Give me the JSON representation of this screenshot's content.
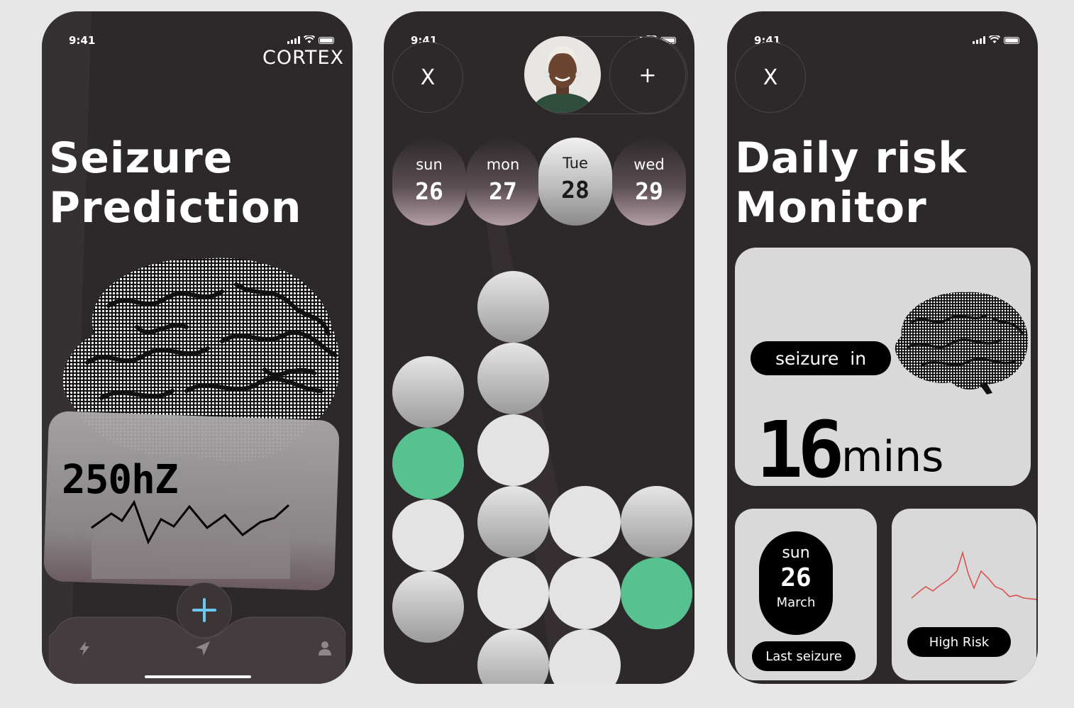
{
  "status": {
    "time": "9:41"
  },
  "screen1": {
    "brand": "CORTEX",
    "title_line1": "Seizure",
    "title_line2": "Prediction",
    "frequency": "250hZ",
    "fab_symbol": "+"
  },
  "screen2": {
    "close_symbol": "X",
    "add_symbol": "+",
    "days": [
      {
        "name": "sun",
        "date": "26",
        "selected": false
      },
      {
        "name": "mon",
        "date": "27",
        "selected": false
      },
      {
        "name": "Tue",
        "date": "28",
        "selected": true
      },
      {
        "name": "wed",
        "date": "29",
        "selected": false
      }
    ]
  },
  "screen3": {
    "close_symbol": "X",
    "title_line1": "Daily risk",
    "title_line2": "Monitor",
    "seizure_label": "seizure  in",
    "minutes_value": "16",
    "minutes_unit": "mins",
    "last_day": "sun",
    "last_date": "26",
    "last_month": "March",
    "last_label": "Last seizure",
    "risk_label": "High Risk"
  },
  "colors": {
    "background": "#e7e7e7",
    "phone": "#2d2829",
    "accent_green": "#57c28f",
    "card": "#d9d9d9",
    "risk_line": "#d9534f",
    "fab_plus": "#6ec7f0"
  }
}
